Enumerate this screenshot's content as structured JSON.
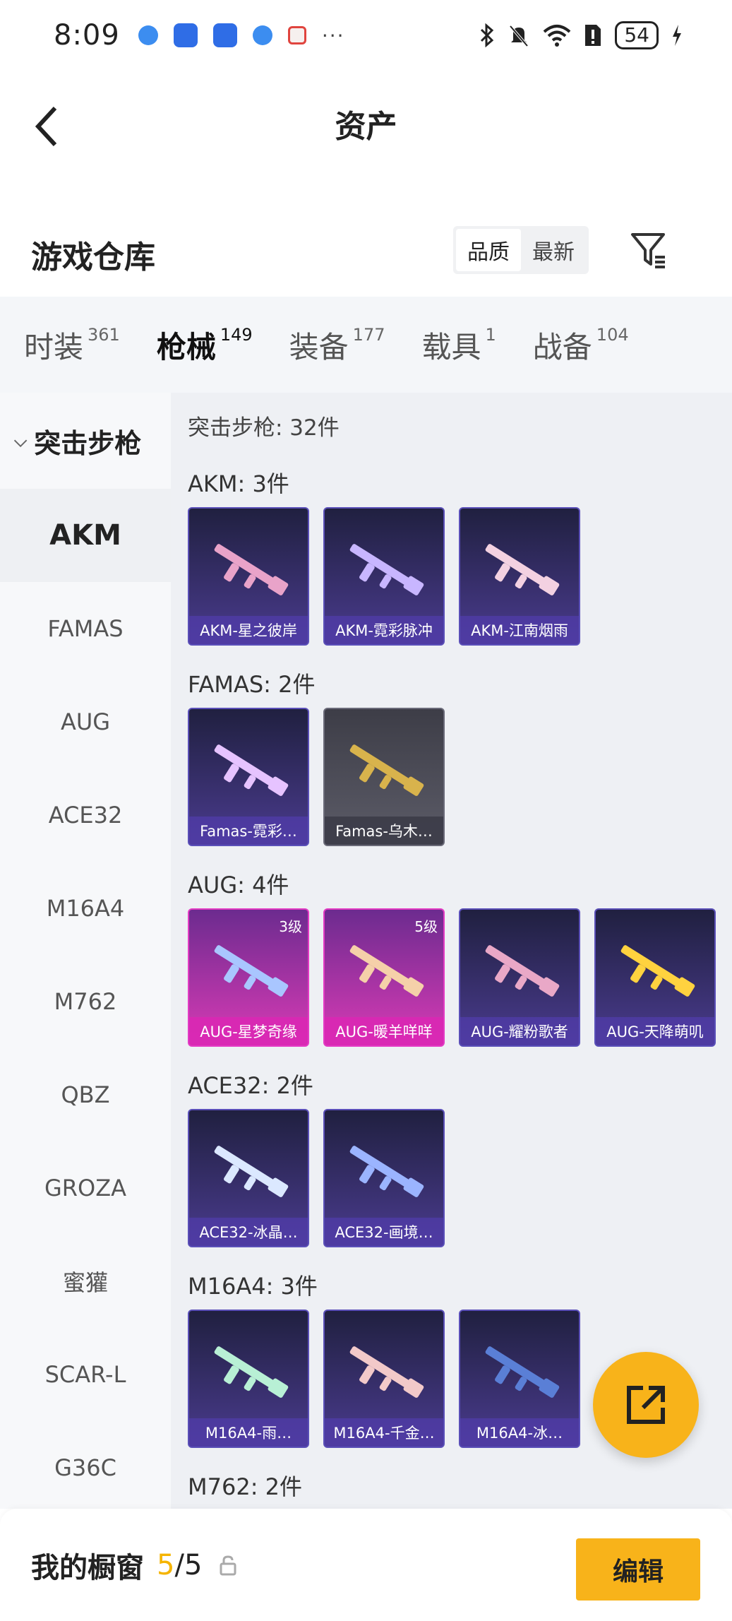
{
  "status_bar": {
    "time": "8:09",
    "more": "···",
    "battery": "54"
  },
  "nav": {
    "title": "资产"
  },
  "header": {
    "title": "游戏仓库",
    "sort_options": [
      "品质",
      "最新"
    ]
  },
  "tabs": [
    {
      "label": "时装",
      "count": "361"
    },
    {
      "label": "枪械",
      "count": "149"
    },
    {
      "label": "装备",
      "count": "177"
    },
    {
      "label": "载具",
      "count": "1"
    },
    {
      "label": "战备",
      "count": "104"
    }
  ],
  "sidebar": {
    "group": "突击步枪",
    "items": [
      "AKM",
      "FAMAS",
      "AUG",
      "ACE32",
      "M16A4",
      "M762",
      "QBZ",
      "GROZA",
      "蜜獾",
      "SCAR-L",
      "G36C"
    ]
  },
  "content": {
    "group_total": "突击步枪: 32件",
    "sections": [
      {
        "title": "AKM: 3件",
        "items": [
          {
            "name": "AKM-星之彼岸",
            "style": "purple"
          },
          {
            "name": "AKM-霓彩脉冲",
            "style": "purple"
          },
          {
            "name": "AKM-江南烟雨",
            "style": "purple"
          }
        ]
      },
      {
        "title": "FAMAS: 2件",
        "items": [
          {
            "name": "Famas-霓彩…",
            "style": "purple"
          },
          {
            "name": "Famas-乌木…",
            "style": "grey"
          }
        ]
      },
      {
        "title": "AUG: 4件",
        "items": [
          {
            "name": "AUG-星梦奇缘",
            "style": "pink",
            "level": "3级"
          },
          {
            "name": "AUG-暖羊咩咩",
            "style": "pink",
            "level": "5级"
          },
          {
            "name": "AUG-耀粉歌者",
            "style": "purple"
          },
          {
            "name": "AUG-天降萌叽",
            "style": "purple"
          }
        ]
      },
      {
        "title": "ACE32: 2件",
        "items": [
          {
            "name": "ACE32-冰晶…",
            "style": "purple"
          },
          {
            "name": "ACE32-画境…",
            "style": "purple"
          }
        ]
      },
      {
        "title": "M16A4: 3件",
        "items": [
          {
            "name": "M16A4-雨…",
            "style": "purple"
          },
          {
            "name": "M16A4-千金…",
            "style": "purple"
          },
          {
            "name": "M16A4-冰…",
            "style": "purple"
          }
        ]
      },
      {
        "title": "M762: 2件",
        "items": []
      }
    ]
  },
  "bottom_bar": {
    "title": "我的橱窗",
    "current": "5",
    "separator": "/",
    "total": "5",
    "edit_label": "编辑"
  },
  "colors": {
    "accent": "#f8b31a",
    "card_purple": "#4a3b8e",
    "card_pink": "#d93bb5"
  },
  "icons": [
    "back-arrow-icon",
    "filter-icon",
    "share-external-icon",
    "lock-icon"
  ]
}
